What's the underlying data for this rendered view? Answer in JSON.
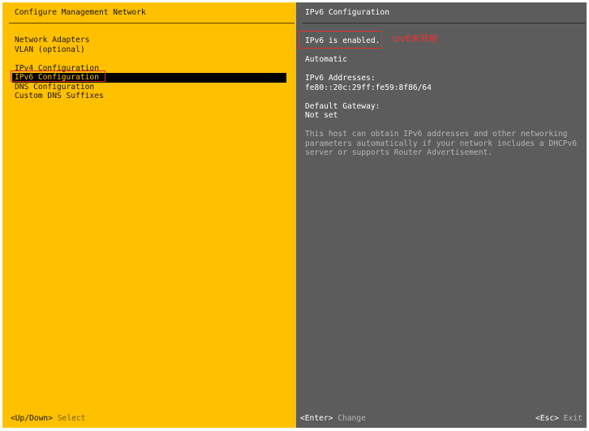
{
  "left_pane": {
    "title": "Configure Management Network",
    "menu": [
      {
        "label": "Network Adapters",
        "selected": false
      },
      {
        "label": "VLAN (optional)",
        "selected": false
      },
      {
        "label": "IPv4 Configuration",
        "selected": false
      },
      {
        "label": "IPv6 Configuration",
        "selected": true
      },
      {
        "label": "DNS Configuration",
        "selected": false
      },
      {
        "label": "Custom DNS Suffixes",
        "selected": false
      }
    ],
    "footer": {
      "key": "<Up/Down>",
      "action": "Select"
    }
  },
  "right_pane": {
    "title": "IPv6 Configuration",
    "status": "IPv6 is enabled.",
    "mode": "Automatic",
    "addresses_label": "IPv6 Addresses:",
    "address": "fe80::20c:29ff:fe59:8f86/64",
    "gateway_label": "Default Gateway:",
    "gateway_value": "Not set",
    "note_lines": [
      "This host can obtain IPv6 addresses and other networking",
      "parameters automatically if your network includes a DHCPv6",
      "server or supports Router Advertisement."
    ],
    "footer_left": {
      "key": "<Enter>",
      "action": "Change"
    },
    "footer_right": {
      "key": "<Esc>",
      "action": "Exit"
    }
  },
  "annotation": {
    "text": "ipv6未开启",
    "color": "#ff2b2b"
  },
  "colors": {
    "left_background": "#ffc000",
    "right_background": "#5c5c5c",
    "selection_background": "#000000"
  }
}
